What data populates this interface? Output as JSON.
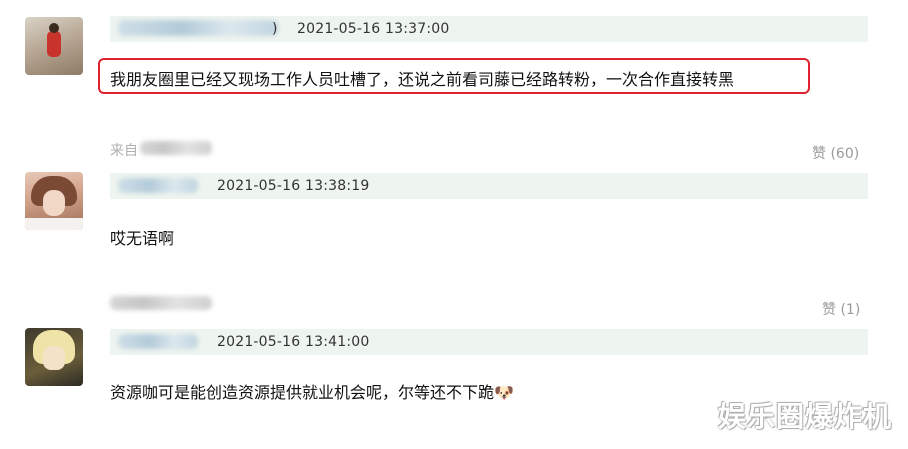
{
  "comments": [
    {
      "timestamp": "2021-05-16 13:37:00",
      "paren": ")",
      "text": "我朋友圈里已经又现场工作人员吐槽了，还说之前看司藤已经路转粉，一次合作直接转黑"
    },
    {
      "from_prefix": "来自",
      "likes": "赞 (60)",
      "timestamp": "2021-05-16 13:38:19",
      "text": "哎无语啊"
    },
    {
      "likes": "赞 (1)",
      "timestamp": "2021-05-16 13:41:00",
      "text": "资源咖可是能创造资源提供就业机会呢，尔等还不下跪🐶"
    }
  ],
  "watermark": "娱乐圈爆炸机",
  "icons": {
    "dog_emoji": "dog-face-emoji"
  }
}
